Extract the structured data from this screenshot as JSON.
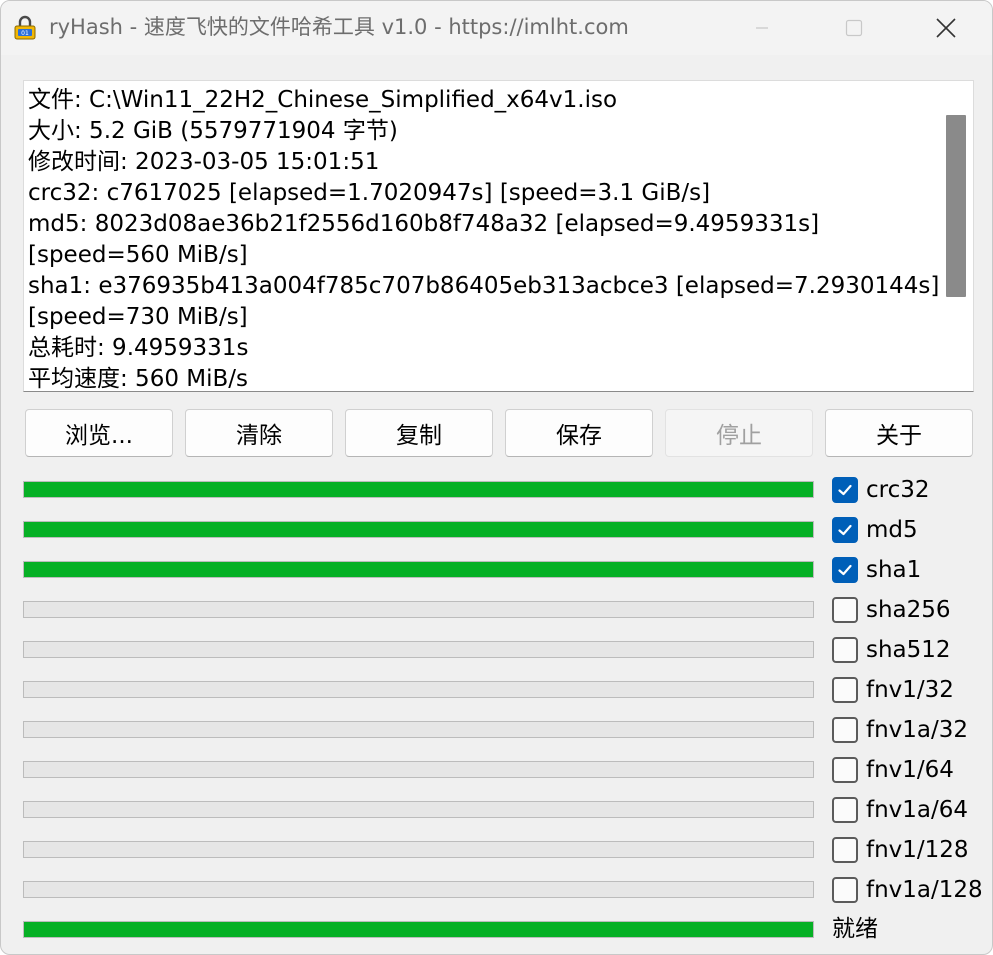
{
  "window": {
    "title": "ryHash - 速度飞快的文件哈希工具 v1.0 - https://imlht.com"
  },
  "log": {
    "lines": [
      "文件: C:\\Win11_22H2_Chinese_Simplified_x64v1.iso",
      "大小: 5.2 GiB (5579771904 字节)",
      "修改时间: 2023-03-05 15:01:51",
      "crc32: c7617025 [elapsed=1.7020947s] [speed=3.1 GiB/s]",
      "md5: 8023d08ae36b21f2556d160b8f748a32 [elapsed=9.4959331s] [speed=560 MiB/s]",
      "sha1: e376935b413a004f785c707b86405eb313acbce3 [elapsed=7.2930144s] [speed=730 MiB/s]",
      "总耗时: 9.4959331s",
      "平均速度: 560 MiB/s"
    ]
  },
  "buttons": {
    "browse": "浏览...",
    "clear": "清除",
    "copy": "复制",
    "save": "保存",
    "stop": "停止",
    "about": "关于"
  },
  "algorithms": [
    {
      "label": "crc32",
      "checked": true,
      "progress": 1.0
    },
    {
      "label": "md5",
      "checked": true,
      "progress": 1.0
    },
    {
      "label": "sha1",
      "checked": true,
      "progress": 1.0
    },
    {
      "label": "sha256",
      "checked": false,
      "progress": 0
    },
    {
      "label": "sha512",
      "checked": false,
      "progress": 0
    },
    {
      "label": "fnv1/32",
      "checked": false,
      "progress": 0
    },
    {
      "label": "fnv1a/32",
      "checked": false,
      "progress": 0
    },
    {
      "label": "fnv1/64",
      "checked": false,
      "progress": 0
    },
    {
      "label": "fnv1a/64",
      "checked": false,
      "progress": 0
    },
    {
      "label": "fnv1/128",
      "checked": false,
      "progress": 0
    },
    {
      "label": "fnv1a/128",
      "checked": false,
      "progress": 0
    }
  ],
  "status": {
    "label": "就绪",
    "progress": 1.0
  },
  "colors": {
    "progress_fill": "#06b025",
    "checkbox_checked": "#005fb8"
  }
}
